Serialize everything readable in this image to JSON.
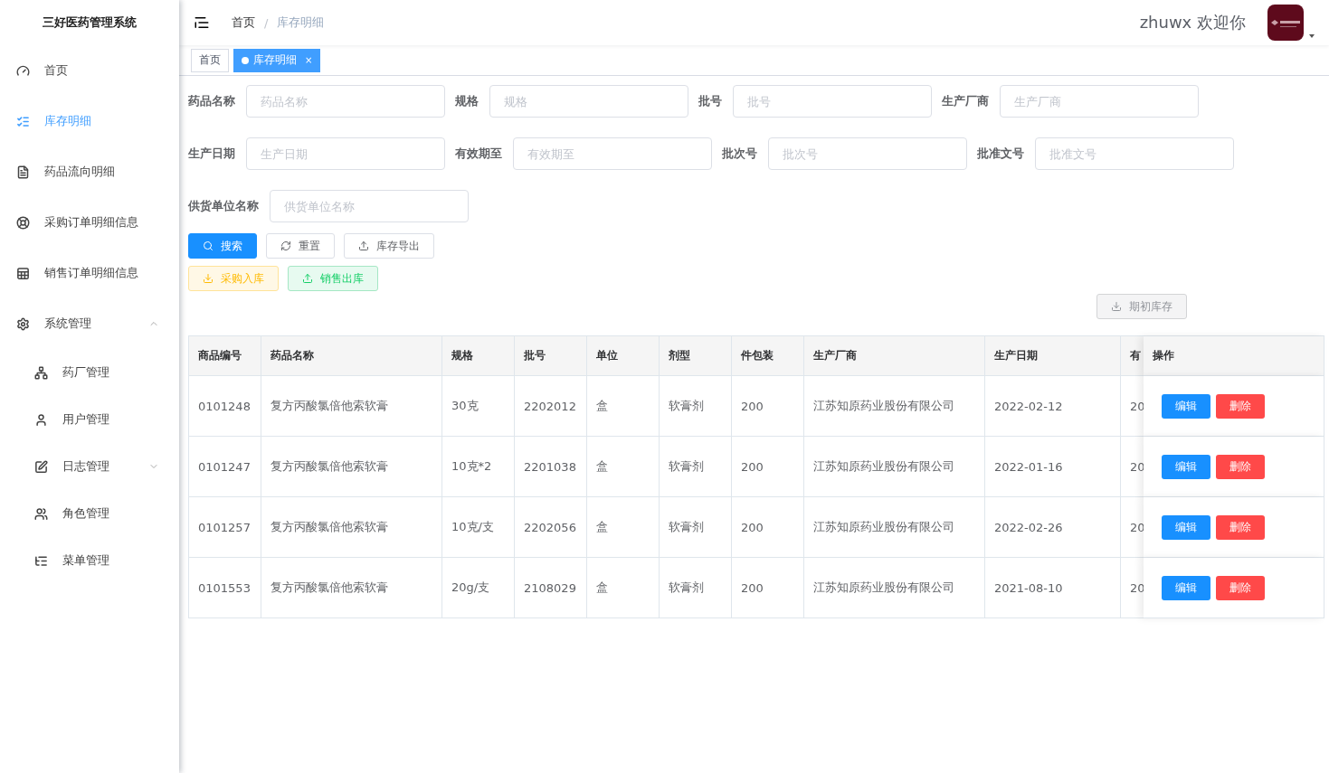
{
  "app_title": "三好医药管理系统",
  "sidebar": {
    "items": [
      {
        "kind": "item",
        "label": "首页",
        "selected": false
      },
      {
        "kind": "item",
        "label": "库存明细",
        "selected": true
      },
      {
        "kind": "item",
        "label": "药品流向明细",
        "selected": false
      },
      {
        "kind": "item",
        "label": "采购订单明细信息",
        "selected": false
      },
      {
        "kind": "item",
        "label": "销售订单明细信息",
        "selected": false
      },
      {
        "kind": "group",
        "label": "系统管理",
        "expanded": true,
        "children": [
          {
            "kind": "item",
            "label": "药厂管理",
            "selected": false
          },
          {
            "kind": "item",
            "label": "用户管理",
            "selected": false
          },
          {
            "kind": "group",
            "label": "日志管理",
            "expanded": false
          },
          {
            "kind": "item",
            "label": "角色管理",
            "selected": false
          },
          {
            "kind": "item",
            "label": "菜单管理",
            "selected": false
          }
        ]
      }
    ]
  },
  "breadcrumb": [
    "首页",
    "库存明细"
  ],
  "breadcrumb_separator": "/",
  "user": {
    "greeting": "zhuwx 欢迎你"
  },
  "tags": [
    {
      "label": "首页",
      "selected": false
    },
    {
      "label": "库存明细",
      "selected": true,
      "close": "×"
    }
  ],
  "filters": [
    [
      {
        "label": "药品名称",
        "placeholder": "药品名称"
      },
      {
        "label": "规格",
        "placeholder": "规格"
      },
      {
        "label": "批号",
        "placeholder": "批号"
      },
      {
        "label": "生产厂商",
        "placeholder": "生产厂商"
      }
    ],
    [
      {
        "label": "生产日期",
        "placeholder": "生产日期"
      },
      {
        "label": "有效期至",
        "placeholder": "有效期至"
      },
      {
        "label": "批次号",
        "placeholder": "批次号"
      },
      {
        "label": "批准文号",
        "placeholder": "批准文号"
      }
    ],
    [
      {
        "label": "供货单位名称",
        "placeholder": "供货单位名称"
      }
    ]
  ],
  "actions": [
    [
      {
        "kind": "primary",
        "label": "搜索"
      },
      {
        "kind": "default",
        "label": "重置"
      },
      {
        "kind": "default",
        "label": "库存导出"
      }
    ],
    [
      {
        "kind": "warning",
        "label": "采购入库"
      },
      {
        "kind": "success",
        "label": "销售出库"
      }
    ]
  ],
  "opening_stock_button": {
    "label": "期初库存"
  },
  "table": {
    "columns": [
      "商品编号",
      "药品名称",
      "规格",
      "批号",
      "单位",
      "剂型",
      "件包装",
      "生产厂商",
      "生产日期",
      "有",
      "操作"
    ],
    "rows": [
      {
        "cells": [
          "0101248",
          "复方丙酸氯倍他索软膏",
          "30克",
          "2202012",
          "盒",
          "软膏剂",
          "200",
          "江苏知原药业股份有限公司",
          "2022-02-12",
          "20"
        ],
        "edit": "编辑",
        "delete": "删除"
      },
      {
        "cells": [
          "0101247",
          "复方丙酸氯倍他索软膏",
          "10克*2",
          "2201038",
          "盒",
          "软膏剂",
          "200",
          "江苏知原药业股份有限公司",
          "2022-01-16",
          "20"
        ],
        "edit": "编辑",
        "delete": "删除"
      },
      {
        "cells": [
          "0101257",
          "复方丙酸氯倍他索软膏",
          "10克/支",
          "2202056",
          "盒",
          "软膏剂",
          "200",
          "江苏知原药业股份有限公司",
          "2022-02-26",
          "20"
        ],
        "edit": "编辑",
        "delete": "删除"
      },
      {
        "cells": [
          "0101553",
          "复方丙酸氯倍他索软膏",
          "20g/支",
          "2108029",
          "盒",
          "软膏剂",
          "200",
          "江苏知原药业股份有限公司",
          "2021-08-10",
          "20"
        ],
        "edit": "编辑",
        "delete": "删除"
      }
    ]
  }
}
